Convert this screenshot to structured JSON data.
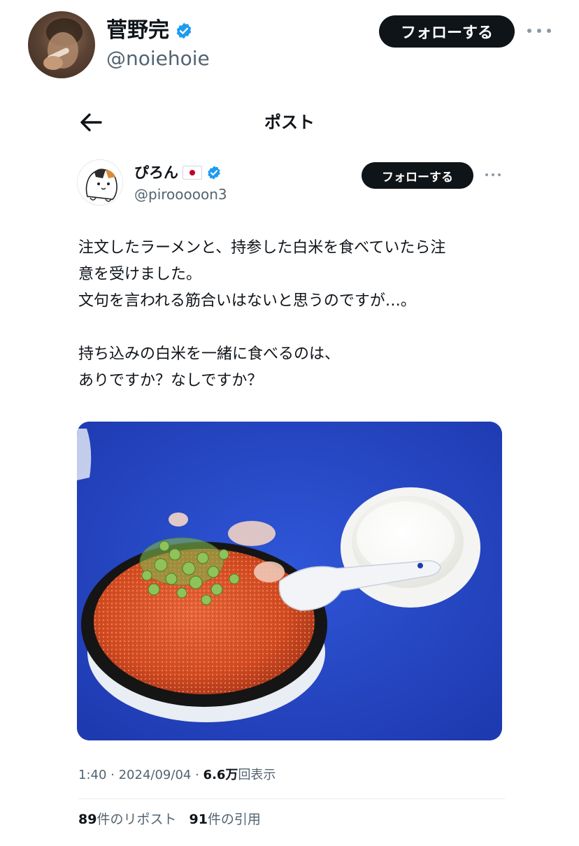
{
  "top_profile": {
    "name": "菅野完",
    "handle": "@noiehoie",
    "follow_label": "フォローする"
  },
  "nav": {
    "title": "ポスト",
    "back_icon": "arrow-left-icon"
  },
  "post": {
    "author_name": "ぴろん",
    "author_handle": "@pirooooon3",
    "follow_label": "フォローする",
    "text_lines": [
      "注文したラーメンと、持参した白米を食べていたら注",
      "意を受けました。",
      "文句を言われる筋合いはないと思うのですが…。",
      "",
      "持ち込みの白米を一緒に食べるのは、",
      "ありですか？なしですか？"
    ],
    "media_description": "ramen-and-rice-photo",
    "time": "1:40",
    "date": "2024/09/04",
    "views_count": "6.6万",
    "views_label": "回表示",
    "reposts_count": "89",
    "reposts_label": "件のリポスト",
    "quotes_count": "91",
    "quotes_label": "件の引用"
  },
  "colors": {
    "text_primary": "#0f1419",
    "text_secondary": "#536471",
    "verified_blue": "#1d9bf0",
    "button_dark": "#0f1419"
  }
}
